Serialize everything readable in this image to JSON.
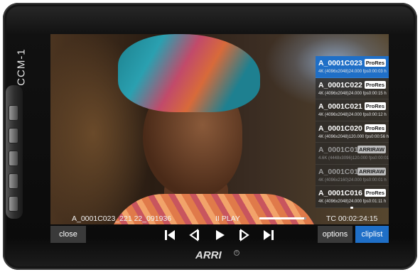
{
  "device": {
    "side_label": "CCM-1",
    "brand": "ARRI",
    "registered_mark": "®"
  },
  "osd": {
    "clip_name": "A_0001C023_221 22_091936",
    "play_state": "II PLAY",
    "progress_fraction": 0.95,
    "timecode": "TC 00:02:24:15"
  },
  "clips": [
    {
      "name": "A_0001C023",
      "codec": "ProRes",
      "resolution": "4K (4096x2048)",
      "fps": "24.000 fps",
      "duration": "0:00:03 h",
      "state": "selected"
    },
    {
      "name": "A_0001C022",
      "codec": "ProRes",
      "resolution": "4K (4096x2048)",
      "fps": "24.000 fps",
      "duration": "0:00:15 h",
      "state": "normal"
    },
    {
      "name": "A_0001C021",
      "codec": "ProRes",
      "resolution": "4K (4096x2048)",
      "fps": "24.000 fps",
      "duration": "0:00:12 h",
      "state": "normal"
    },
    {
      "name": "A_0001C020",
      "codec": "ProRes",
      "resolution": "4K (4096x2048)",
      "fps": "120.000 fps",
      "duration": "0:00:56 h",
      "state": "normal"
    },
    {
      "name": "A_0001C018",
      "codec": "ARRIRAW",
      "resolution": "4.6K (4448x3096)",
      "fps": "120.000 fps",
      "duration": "0:00:01 h",
      "state": "dim"
    },
    {
      "name": "A_0001C017",
      "codec": "ARRIRAW",
      "resolution": "4K (4096x2160)",
      "fps": "24.000 fps",
      "duration": "0:00:01 h",
      "state": "dim"
    },
    {
      "name": "A_0001C016",
      "codec": "ProRes",
      "resolution": "4K (4096x2048)",
      "fps": "24.000 fps",
      "duration": "0:01:11 h",
      "state": "normal"
    }
  ],
  "controls": {
    "close_label": "close",
    "options_label": "options",
    "cliplist_label": "cliplist",
    "transport_icons": [
      "skip-to-start-icon",
      "step-back-icon",
      "play-icon",
      "step-forward-icon",
      "skip-to-end-icon"
    ]
  },
  "colors": {
    "accent": "#1f6fc7",
    "button_gray": "#3a3a3a"
  }
}
